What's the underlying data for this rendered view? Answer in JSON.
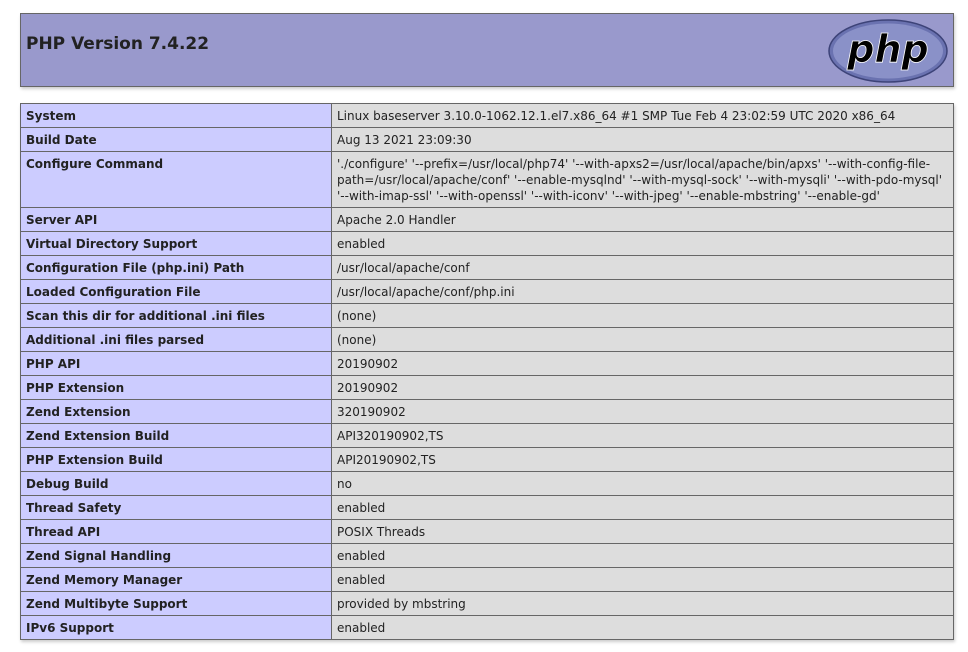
{
  "header": {
    "title": "PHP Version 7.4.22",
    "logo_text": "php",
    "logo_icon": "php-logo-icon"
  },
  "colors": {
    "header_bg": "#9999cc",
    "key_cell_bg": "#ccccff",
    "value_cell_bg": "#dddddd",
    "border": "#666666"
  },
  "rows": [
    {
      "key": "System",
      "value": "Linux baseserver 3.10.0-1062.12.1.el7.x86_64 #1 SMP Tue Feb 4 23:02:59 UTC 2020 x86_64"
    },
    {
      "key": "Build Date",
      "value": "Aug 13 2021 23:09:30"
    },
    {
      "key": "Configure Command",
      "value": "'./configure' '--prefix=/usr/local/php74' '--with-apxs2=/usr/local/apache/bin/apxs' '--with-config-file-path=/usr/local/apache/conf' '--enable-mysqlnd' '--with-mysql-sock' '--with-mysqli' '--with-pdo-mysql' '--with-imap-ssl' '--with-openssl' '--with-iconv' '--with-jpeg' '--enable-mbstring' '--enable-gd'"
    },
    {
      "key": "Server API",
      "value": "Apache 2.0 Handler"
    },
    {
      "key": "Virtual Directory Support",
      "value": "enabled"
    },
    {
      "key": "Configuration File (php.ini) Path",
      "value": "/usr/local/apache/conf"
    },
    {
      "key": "Loaded Configuration File",
      "value": "/usr/local/apache/conf/php.ini"
    },
    {
      "key": "Scan this dir for additional .ini files",
      "value": "(none)"
    },
    {
      "key": "Additional .ini files parsed",
      "value": "(none)"
    },
    {
      "key": "PHP API",
      "value": "20190902"
    },
    {
      "key": "PHP Extension",
      "value": "20190902"
    },
    {
      "key": "Zend Extension",
      "value": "320190902"
    },
    {
      "key": "Zend Extension Build",
      "value": "API320190902,TS"
    },
    {
      "key": "PHP Extension Build",
      "value": "API20190902,TS"
    },
    {
      "key": "Debug Build",
      "value": "no"
    },
    {
      "key": "Thread Safety",
      "value": "enabled"
    },
    {
      "key": "Thread API",
      "value": "POSIX Threads"
    },
    {
      "key": "Zend Signal Handling",
      "value": "enabled"
    },
    {
      "key": "Zend Memory Manager",
      "value": "enabled"
    },
    {
      "key": "Zend Multibyte Support",
      "value": "provided by mbstring"
    },
    {
      "key": "IPv6 Support",
      "value": "enabled"
    }
  ]
}
